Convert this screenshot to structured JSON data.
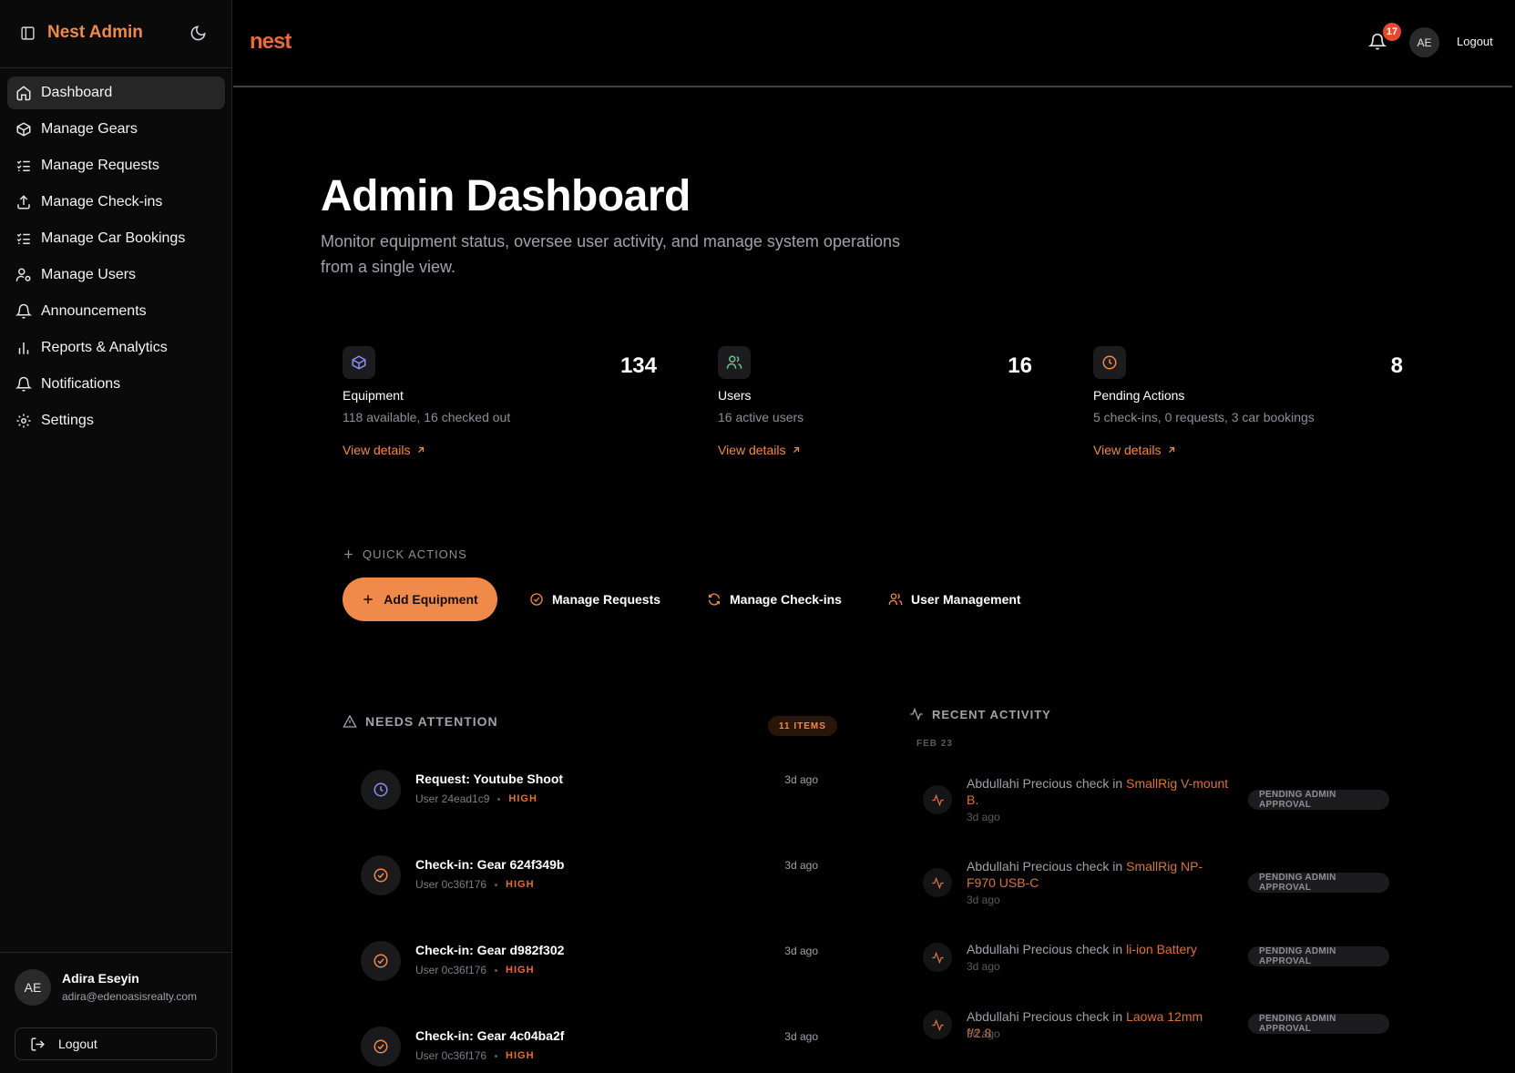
{
  "sidebar": {
    "brand": "Nest Admin",
    "nav": [
      {
        "label": "Dashboard",
        "icon": "home-icon",
        "active": true
      },
      {
        "label": "Manage Gears",
        "icon": "box-icon"
      },
      {
        "label": "Manage Requests",
        "icon": "list-checks-icon"
      },
      {
        "label": "Manage Check-ins",
        "icon": "upload-icon"
      },
      {
        "label": "Manage Car Bookings",
        "icon": "list-checks-icon"
      },
      {
        "label": "Manage Users",
        "icon": "user-cog-icon"
      },
      {
        "label": "Announcements",
        "icon": "bell-icon"
      },
      {
        "label": "Reports & Analytics",
        "icon": "bar-chart-icon"
      },
      {
        "label": "Notifications",
        "icon": "bell-icon"
      },
      {
        "label": "Settings",
        "icon": "gear-icon"
      }
    ],
    "user": {
      "initials": "AE",
      "name": "Adira Eseyin",
      "email": "adira@edenoasisrealty.com"
    },
    "logout_label": "Logout"
  },
  "header": {
    "notification_count": "17",
    "avatar_initials": "AE",
    "logout_label": "Logout",
    "accent": "#ef8a4a"
  },
  "page": {
    "title": "Admin Dashboard",
    "subtitle": "Monitor equipment status, oversee user activity, and manage system operations from a single view."
  },
  "stats": [
    {
      "label": "Equipment",
      "value": "134",
      "sub": "118 available, 16 checked out",
      "link": "View details",
      "icon": "box-icon",
      "color": "#8b8cf6"
    },
    {
      "label": "Users",
      "value": "16",
      "sub": "16 active users",
      "link": "View details",
      "icon": "users-icon",
      "color": "#6cc08a"
    },
    {
      "label": "Pending Actions",
      "value": "8",
      "sub": "5 check-ins, 0 requests, 3 car bookings",
      "link": "View details",
      "icon": "clock-icon",
      "color": "#ef8a4a"
    }
  ],
  "quick_actions": {
    "heading": "QUICK ACTIONS",
    "primary": "Add Equipment",
    "buttons": [
      "Manage Requests",
      "Manage Check-ins",
      "User Management"
    ]
  },
  "attention": {
    "heading": "NEEDS ATTENTION",
    "count_label": "11 ITEMS",
    "items": [
      {
        "title": "Request: Youtube Shoot",
        "user": "User 24ead1c9",
        "priority": "HIGH",
        "time": "3d ago",
        "icon": "clock-icon"
      },
      {
        "title": "Check-in: Gear 624f349b",
        "user": "User 0c36f176",
        "priority": "HIGH",
        "time": "3d ago",
        "icon": "check-circle-icon"
      },
      {
        "title": "Check-in: Gear d982f302",
        "user": "User 0c36f176",
        "priority": "HIGH",
        "time": "3d ago",
        "icon": "check-circle-icon"
      },
      {
        "title": "Check-in: Gear 4c04ba2f",
        "user": "User 0c36f176",
        "priority": "HIGH",
        "time": "3d ago",
        "icon": "check-circle-icon"
      }
    ]
  },
  "activity": {
    "heading": "RECENT ACTIVITY",
    "date_label": "FEB 23",
    "items": [
      {
        "prefix": "Abdullahi Precious check in ",
        "item": "SmallRig V-mount B.",
        "time": "3d ago",
        "status": "PENDING ADMIN APPROVAL"
      },
      {
        "prefix": "Abdullahi Precious check in ",
        "item": "SmallRig NP-F970 USB-C",
        "time": "3d ago",
        "status": "PENDING ADMIN APPROVAL"
      },
      {
        "prefix": "Abdullahi Precious check in ",
        "item": "li-ion Battery",
        "time": "3d ago",
        "status": "PENDING ADMIN APPROVAL"
      },
      {
        "prefix": "Abdullahi Precious check in ",
        "item": "Laowa 12mm f/2.8",
        "time": "3d ago",
        "status": "PENDING ADMIN APPROVAL"
      }
    ]
  }
}
